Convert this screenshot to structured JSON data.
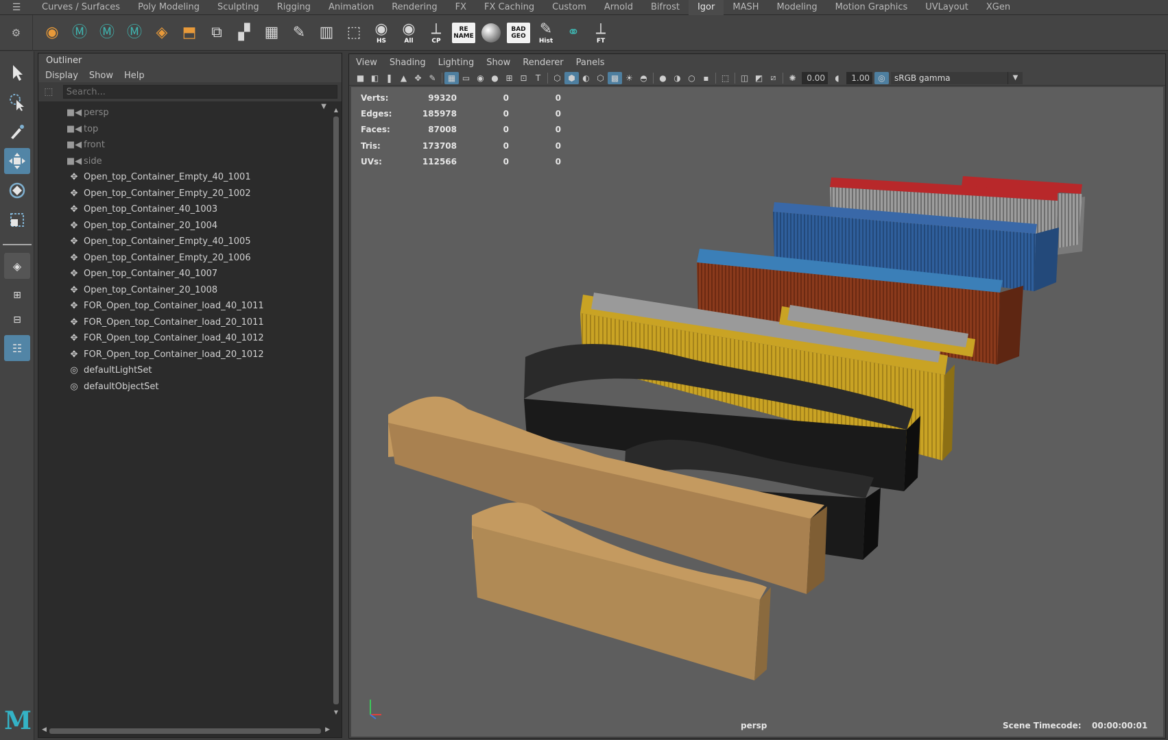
{
  "shelf_tabs": [
    "Curves / Surfaces",
    "Poly Modeling",
    "Sculpting",
    "Rigging",
    "Animation",
    "Rendering",
    "FX",
    "FX Caching",
    "Custom",
    "Arnold",
    "Bifrost",
    "Igor",
    "MASH",
    "Modeling",
    "Motion Graphics",
    "UVLayout",
    "XGen"
  ],
  "active_shelf_tab": "Igor",
  "shelf_buttons": [
    {
      "name": "layer-icon",
      "caption": ""
    },
    {
      "name": "maya-m-icon",
      "caption": ""
    },
    {
      "name": "maya-m-icon-2",
      "caption": ""
    },
    {
      "name": "maya-m-icon-3",
      "caption": ""
    },
    {
      "name": "layer-stack-icon",
      "caption": ""
    },
    {
      "name": "extrude-icon",
      "caption": ""
    },
    {
      "name": "planes-icon",
      "caption": ""
    },
    {
      "name": "grid-icon",
      "caption": ""
    },
    {
      "name": "mesh-grid-icon",
      "caption": ""
    },
    {
      "name": "pencil-icon",
      "caption": ""
    },
    {
      "name": "split-icon",
      "caption": ""
    },
    {
      "name": "marquee-pencil-icon",
      "caption": ""
    },
    {
      "name": "eye-hs-icon",
      "caption": "HS"
    },
    {
      "name": "eye-all-icon",
      "caption": "All"
    },
    {
      "name": "axis-cp-icon",
      "caption": "CP"
    },
    {
      "name": "rename-icon",
      "caption": "RE NAME"
    },
    {
      "name": "sphere-icon",
      "caption": ""
    },
    {
      "name": "bad-geo-icon",
      "caption": "BAD GEO"
    },
    {
      "name": "history-icon",
      "caption": "Hist"
    },
    {
      "name": "magnet-icon",
      "caption": ""
    },
    {
      "name": "axis-ft-icon",
      "caption": "FT"
    }
  ],
  "outliner": {
    "title": "Outliner",
    "menu": [
      "Display",
      "Show",
      "Help"
    ],
    "search_placeholder": "Search...",
    "items": [
      {
        "label": "persp",
        "type": "camera"
      },
      {
        "label": "top",
        "type": "camera"
      },
      {
        "label": "front",
        "type": "camera"
      },
      {
        "label": "side",
        "type": "camera"
      },
      {
        "label": "Open_top_Container_Empty_40_1001",
        "type": "transform"
      },
      {
        "label": "Open_top_Container_Empty_20_1002",
        "type": "transform"
      },
      {
        "label": "Open_top_Container_40_1003",
        "type": "transform"
      },
      {
        "label": "Open_top_Container_20_1004",
        "type": "transform"
      },
      {
        "label": "Open_top_Container_Empty_40_1005",
        "type": "transform"
      },
      {
        "label": "Open_top_Container_Empty_20_1006",
        "type": "transform"
      },
      {
        "label": "Open_top_Container_40_1007",
        "type": "transform"
      },
      {
        "label": "Open_top_Container_20_1008",
        "type": "transform"
      },
      {
        "label": "FOR_Open_top_Container_load_40_1011",
        "type": "transform"
      },
      {
        "label": "FOR_Open_top_Container_load_20_1011",
        "type": "transform"
      },
      {
        "label": "FOR_Open_top_Container_load_40_1012",
        "type": "transform"
      },
      {
        "label": "FOR_Open_top_Container_load_20_1012",
        "type": "transform"
      },
      {
        "label": "defaultLightSet",
        "type": "set"
      },
      {
        "label": "defaultObjectSet",
        "type": "set"
      }
    ]
  },
  "viewport": {
    "menu": [
      "View",
      "Shading",
      "Lighting",
      "Show",
      "Renderer",
      "Panels"
    ],
    "exposure": "0.00",
    "gamma": "1.00",
    "color_space": "sRGB gamma",
    "stats": [
      {
        "label": "Verts:",
        "v1": "99320",
        "v2": "0",
        "v3": "0"
      },
      {
        "label": "Edges:",
        "v1": "185978",
        "v2": "0",
        "v3": "0"
      },
      {
        "label": "Faces:",
        "v1": "87008",
        "v2": "0",
        "v3": "0"
      },
      {
        "label": "Tris:",
        "v1": "173708",
        "v2": "0",
        "v3": "0"
      },
      {
        "label": "UVs:",
        "v1": "112566",
        "v2": "0",
        "v3": "0"
      }
    ],
    "camera": "persp",
    "timecode_label": "Scene Timecode:",
    "timecode": "00:00:00:01"
  },
  "colors": {
    "accent": "#5285a6",
    "container_red": "#b8282a",
    "container_blue": "#2f5f9c",
    "container_rust": "#8a3a1c",
    "container_yellow": "#c9a324",
    "load_black": "#1c1c1c",
    "load_sand": "#b08a55"
  }
}
